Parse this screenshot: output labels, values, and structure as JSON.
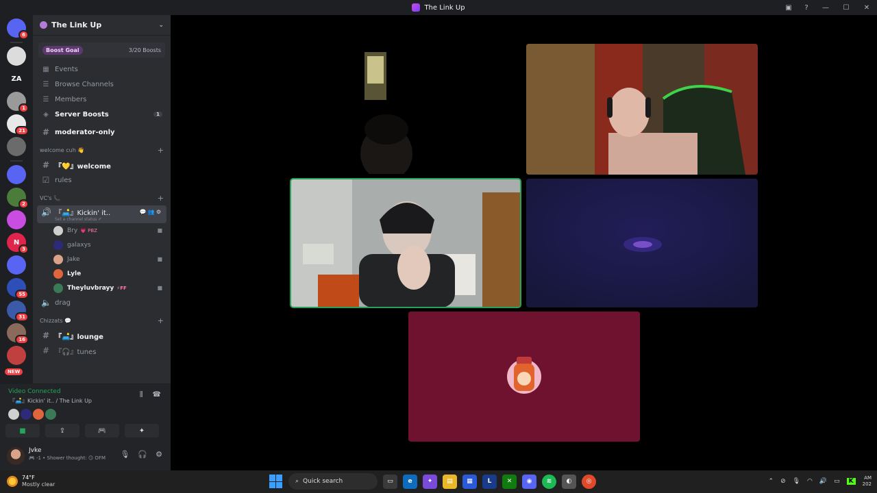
{
  "window": {
    "title": "The Link Up"
  },
  "servers": {
    "items": [
      {
        "name": "discord-home",
        "color": "#5865f2",
        "badge": "6",
        "label": ""
      },
      {
        "name": "server-fortis",
        "color": "#dcdcdc",
        "badge": "",
        "label": ""
      },
      {
        "name": "server-za",
        "color": "#1e1f22",
        "badge": "",
        "label": "ZA"
      },
      {
        "name": "server-crowd",
        "color": "#9a9a9a",
        "badge": "1",
        "label": ""
      },
      {
        "name": "server-skull",
        "color": "#e8e8e8",
        "badge": "21",
        "label": ""
      },
      {
        "name": "server-fog",
        "color": "#6b6b6b",
        "badge": "",
        "label": ""
      },
      {
        "name": "server-folder",
        "color": "#5865f2",
        "badge": "",
        "label": ""
      },
      {
        "name": "server-green",
        "color": "#4b7c3a",
        "badge": "2",
        "label": ""
      },
      {
        "name": "server-linkup",
        "color": "#c84de0",
        "badge": "",
        "label": ""
      },
      {
        "name": "server-n",
        "color": "#e0244c",
        "badge": "3",
        "label": "N"
      },
      {
        "name": "server-folder-2",
        "color": "#5865f2",
        "badge": "",
        "label": ""
      },
      {
        "name": "server-blue",
        "color": "#2f4fb8",
        "badge": "55",
        "label": ""
      },
      {
        "name": "server-girl",
        "color": "#3b5ba8",
        "badge": "31",
        "label": ""
      },
      {
        "name": "server-face",
        "color": "#8a6a5a",
        "badge": "16",
        "label": ""
      },
      {
        "name": "server-red",
        "color": "#c04040",
        "badge": "",
        "label": ""
      }
    ],
    "new_label": "NEW"
  },
  "guild": {
    "name": "The Link Up",
    "boost_goal": "Boost Goal",
    "boost_count": "3/20 Boosts",
    "nav": [
      {
        "label": "Events",
        "icon": "calendar-icon",
        "glyph": "▦",
        "bold": false,
        "count": ""
      },
      {
        "label": "Browse Channels",
        "icon": "browse-channels-icon",
        "glyph": "☰",
        "bold": false,
        "count": ""
      },
      {
        "label": "Members",
        "icon": "members-icon",
        "glyph": "☰",
        "bold": false,
        "count": ""
      },
      {
        "label": "Server Boosts",
        "icon": "boost-icon",
        "glyph": "◈",
        "bold": true,
        "count": "1"
      }
    ],
    "moderator_channel": "moderator-only",
    "categories": {
      "welcome": "welcome cuh 👋",
      "vcs": "VC's 📞",
      "chizzats": "Chizzats 💬"
    },
    "welcome_channels": [
      {
        "label": "『💛』welcome",
        "bold": true,
        "icon": "#"
      },
      {
        "label": "rules",
        "bold": false,
        "icon": "☑"
      }
    ],
    "active_voice": {
      "label": "『🛋️』Kickin' it..",
      "status": "Set a channel status ✐"
    },
    "voice_users": [
      {
        "name": "Bry",
        "tag": "💗 PBZ",
        "color": "#cfcfcf",
        "cam": true,
        "hl": false
      },
      {
        "name": "galaxys",
        "tag": "",
        "color": "#2d2a7a",
        "cam": false,
        "hl": false
      },
      {
        "name": "Jake",
        "tag": "",
        "color": "#d9a38a",
        "cam": true,
        "hl": false
      },
      {
        "name": "Lyle",
        "tag": "",
        "color": "#e0643c",
        "cam": false,
        "hl": true
      },
      {
        "name": "Theyluvbrayy",
        "tag": "⚡FF",
        "color": "#3a7a56",
        "cam": true,
        "hl": true
      }
    ],
    "drag_channel": "drag",
    "chat_channels": [
      {
        "label": "『🛋️』lounge",
        "bold": true
      },
      {
        "label": "『🎧』tunes",
        "bold": false
      }
    ]
  },
  "voice_panel": {
    "status": "Video Connected",
    "channel": "『🛋️』Kickin' it.. / The Link Up",
    "avatar_colors": [
      "#cfcfcf",
      "#2d2a7a",
      "#e0643c",
      "#3a7a56"
    ]
  },
  "user": {
    "name": "Jvke",
    "status": "🎮 -1 • Shower thought: 😏 OFM"
  },
  "taskbar": {
    "weather_temp": "74°F",
    "weather_desc": "Mostly clear",
    "search_placeholder": "Quick search",
    "clock_line1": "AM",
    "clock_line2": "202"
  },
  "colors": {
    "accent": "#5865f2",
    "speaking": "#23a55a",
    "tile_bg_red": "#6e1230",
    "tile_bg_navy": "#1a1845"
  }
}
